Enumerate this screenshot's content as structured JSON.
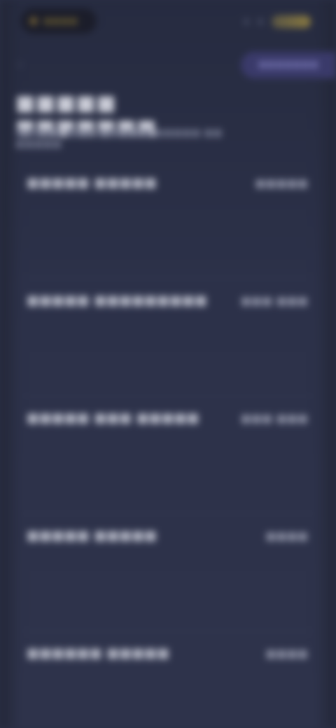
{
  "status_bar": {
    "brand_label": "■■■■",
    "battery_label": ""
  },
  "header": {
    "back_icon": "back-arrow-icon",
    "action_label": "■■■■■■■"
  },
  "page": {
    "title": "■■■■■ ■■■■■■■",
    "subtitle": "■■■■■ ■■■ ■■■■■■ ■■■■■ ■■ ■■■■■"
  },
  "items": [
    {
      "label": "■■■■■ ■■■■■",
      "value": "■■■■■"
    },
    {
      "label": "■■■■■ ■■■■■■■■■",
      "value": "■■■ ■■■"
    },
    {
      "label": "■■■■■ ■■■ ■■■■■",
      "value": "■■■ ■■■"
    },
    {
      "label": "■■■■■ ■■■■■",
      "value": "■■■■"
    },
    {
      "label": "■■■■■■ ■■■■■",
      "value": "■■■■"
    }
  ]
}
